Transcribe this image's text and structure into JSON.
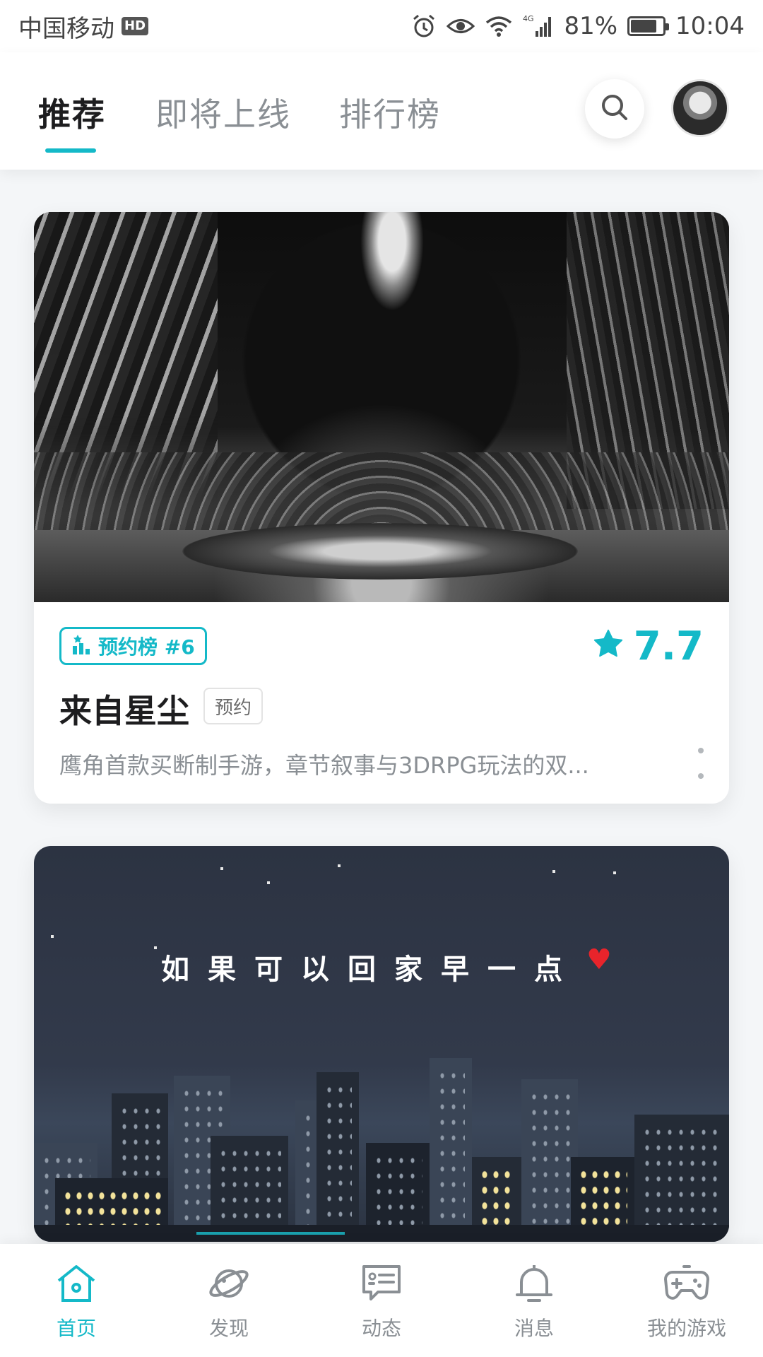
{
  "status_bar": {
    "carrier": "中国移动",
    "hd_badge": "HD",
    "network": "4G",
    "battery": "81%",
    "battery_level": 0.81,
    "time": "10:04"
  },
  "top_nav": {
    "tabs": [
      {
        "label": "推荐",
        "active": true
      },
      {
        "label": "即将上线",
        "active": false
      },
      {
        "label": "排行榜",
        "active": false
      }
    ]
  },
  "cards": [
    {
      "rank_badge": "预约榜 #6",
      "rating": "7.7",
      "title": "来自星尘",
      "tag": "预约",
      "description": "鹰角首款买断制手游，章节叙事与3DRPG玩法的双..."
    },
    {
      "pixel_title": "如果可以回家早一点"
    }
  ],
  "bottom_nav": {
    "items": [
      {
        "label": "首页",
        "icon": "home-icon",
        "active": true
      },
      {
        "label": "发现",
        "icon": "planet-icon",
        "active": false
      },
      {
        "label": "动态",
        "icon": "feed-chat-icon",
        "active": false
      },
      {
        "label": "消息",
        "icon": "bell-icon",
        "active": false
      },
      {
        "label": "我的游戏",
        "icon": "gamepad-icon",
        "active": false
      }
    ]
  },
  "colors": {
    "accent": "#14b9c8",
    "text_primary": "#1d1d1f",
    "text_secondary": "#8a8f94",
    "background": "#f4f6f8"
  }
}
